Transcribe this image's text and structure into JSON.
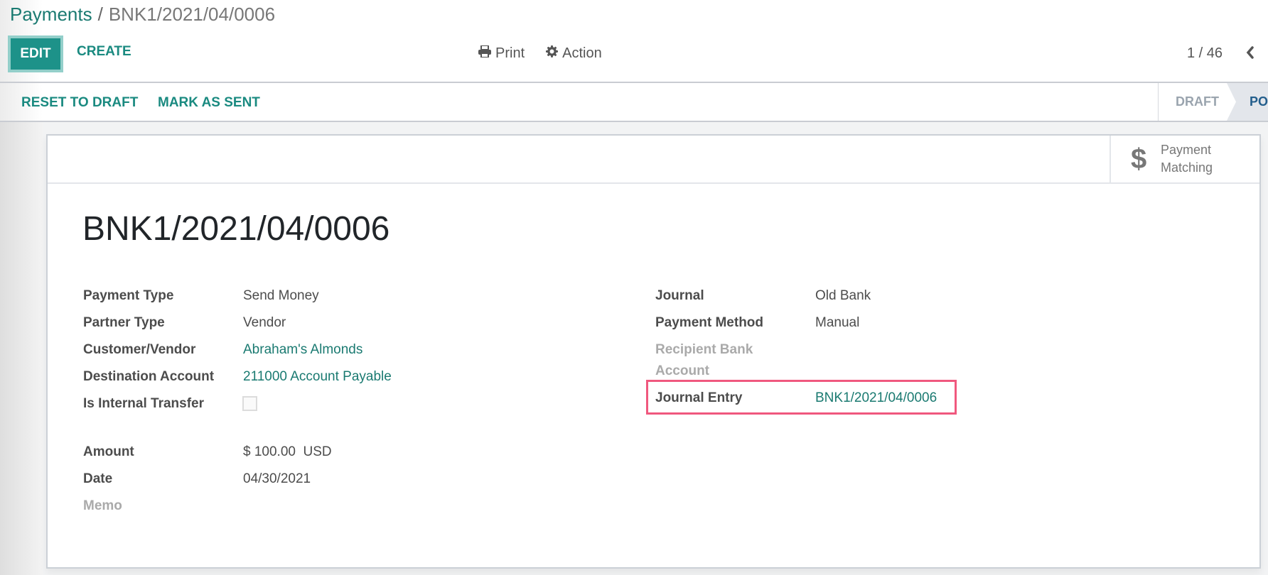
{
  "breadcrumb": {
    "parent": "Payments",
    "separator": "/",
    "current": "BNK1/2021/04/0006"
  },
  "toolbar": {
    "edit_label": "EDIT",
    "create_label": "CREATE",
    "print_label": "Print",
    "action_label": "Action",
    "print_icon": "printer-icon",
    "action_icon": "gear-icon"
  },
  "pager": {
    "value": "1 / 46",
    "prev_icon": "chevron-left-icon"
  },
  "statusbar": {
    "buttons": [
      "RESET TO DRAFT",
      "MARK AS SENT"
    ],
    "steps": [
      {
        "label": "DRAFT",
        "active": false
      },
      {
        "label": "POSTED",
        "active": true
      }
    ]
  },
  "smart_button": {
    "icon": "dollar-icon",
    "line1": "Payment",
    "line2": "Matching"
  },
  "record": {
    "title": "BNK1/2021/04/0006",
    "left_fields": [
      {
        "label": "Payment Type",
        "value": "Send Money"
      },
      {
        "label": "Partner Type",
        "value": "Vendor"
      },
      {
        "label": "Customer/Vendor",
        "value": "Abraham's Almonds"
      },
      {
        "label": "Destination Account",
        "value": "211000 Account Payable"
      },
      {
        "label": "Is Internal Transfer",
        "value": false
      }
    ],
    "left_fields2": [
      {
        "label": "Amount",
        "value": "$ 100.00  USD"
      },
      {
        "label": "Date",
        "value": "04/30/2021"
      },
      {
        "label": "Memo",
        "value": ""
      }
    ],
    "right_fields": [
      {
        "label": "Journal",
        "value": "Old Bank"
      },
      {
        "label": "Payment Method",
        "value": "Manual"
      },
      {
        "label_line1": "Recipient Bank",
        "label_line2": "Account",
        "value": ""
      },
      {
        "label": "Journal Entry",
        "value": "BNK1/2021/04/0006"
      }
    ]
  },
  "colors": {
    "brand": "#1d9289",
    "link": "#1a7a71",
    "highlight": "#f0587e",
    "active_step": "#235e8c"
  }
}
